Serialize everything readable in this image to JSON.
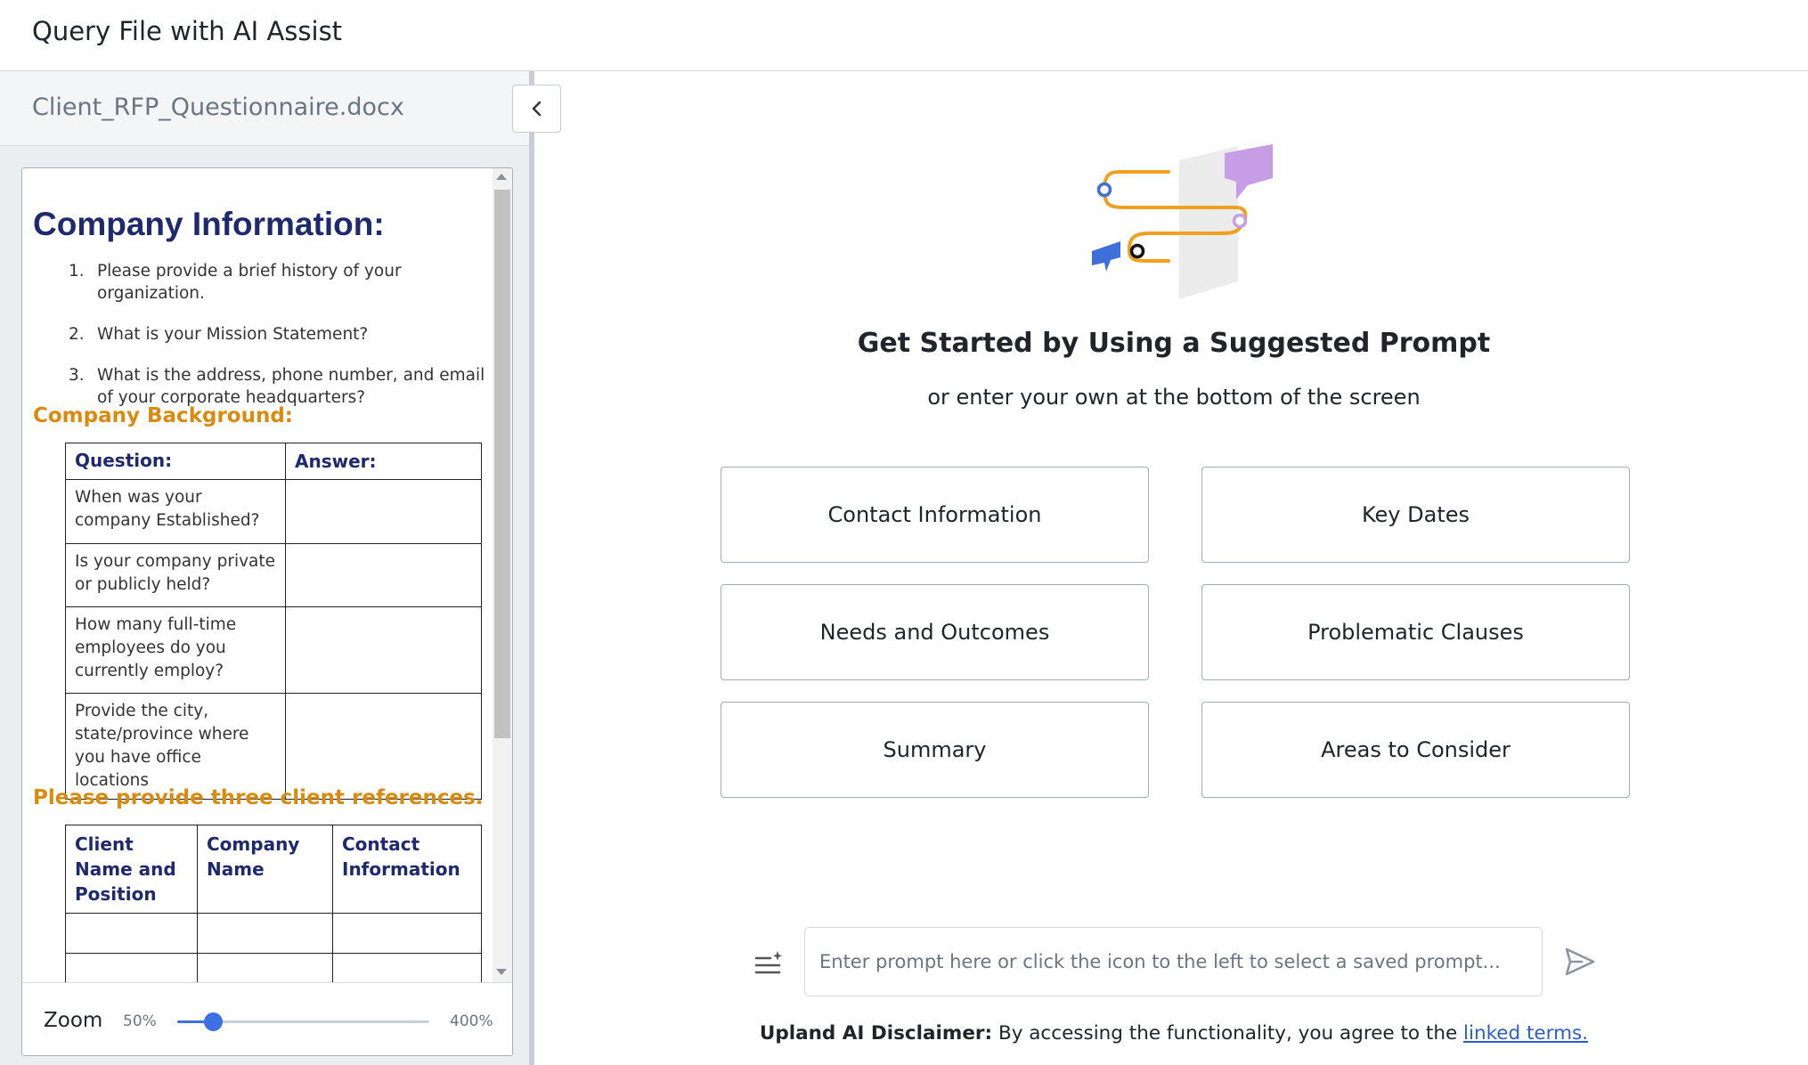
{
  "header": {
    "title": "Query File with AI Assist"
  },
  "file_panel": {
    "file_name": "Client_RFP_Questionnaire.docx",
    "collapse_icon": "chevron-left-icon",
    "document": {
      "heading": "Company Information:",
      "questions": [
        {
          "num": "1.",
          "text": "Please provide a brief history of your organization."
        },
        {
          "num": "2.",
          "text": "What is your Mission Statement?"
        },
        {
          "num": "3.",
          "text": "What is the address, phone number, and email of your corporate headquarters?"
        }
      ],
      "background_heading": "Company Background:",
      "background_table": {
        "headers": [
          "Question:",
          "Answer:"
        ],
        "rows": [
          [
            "When was your company Established?",
            ""
          ],
          [
            "Is your company private or publicly held?",
            ""
          ],
          [
            "How many full-time employees do you currently employ?",
            ""
          ],
          [
            "Provide the city, state/province where you have office locations",
            ""
          ]
        ]
      },
      "references_heading": "Please provide three client references.",
      "references_table": {
        "headers": [
          "Client Name and Position",
          "Company Name",
          "Contact Information"
        ],
        "rows": [
          [
            "",
            "",
            ""
          ],
          [
            "",
            "",
            ""
          ]
        ]
      }
    },
    "zoom": {
      "label": "Zoom",
      "min_label": "50%",
      "max_label": "400%",
      "min": 50,
      "max": 400,
      "value": 100
    }
  },
  "main": {
    "title": "Get Started by Using a Suggested Prompt",
    "subtitle": "or enter your own at the bottom of the screen",
    "suggested_prompts": [
      "Contact Information",
      "Key Dates",
      "Needs and Outcomes",
      "Problematic Clauses",
      "Summary",
      "Areas to Consider"
    ],
    "input": {
      "placeholder": "Enter prompt here or click the icon to the left to select a saved prompt...",
      "value": ""
    },
    "saved_prompt_icon": "list-sparkle-icon",
    "send_icon": "send-icon",
    "disclaimer": {
      "label": "Upland AI Disclaimer:",
      "text": " By accessing the functionality, you agree to the ",
      "link": "linked terms."
    }
  },
  "colors": {
    "accent": "#3f6fe4",
    "doc_heading": "#1f2a6e",
    "doc_subheading": "#d98b0f",
    "link": "#2a5fcc",
    "illustration_orange": "#f0a01f",
    "illustration_purple": "#c79de6",
    "illustration_blue": "#3f6fd9"
  }
}
